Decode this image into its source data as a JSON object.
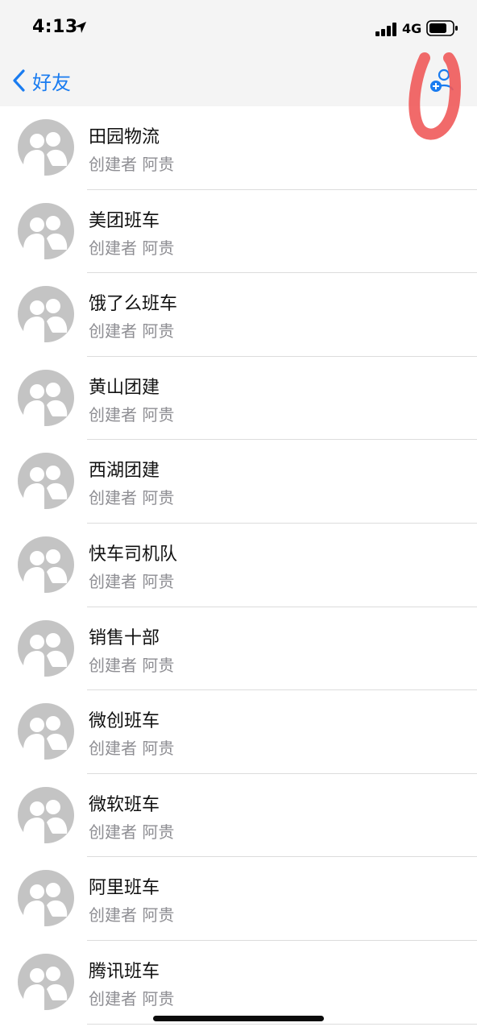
{
  "status": {
    "time": "4:13",
    "network": "4G"
  },
  "nav": {
    "back_label": "好友"
  },
  "groups": [
    {
      "name": "田园物流",
      "creator": "创建者 阿贵"
    },
    {
      "name": "美团班车",
      "creator": "创建者 阿贵"
    },
    {
      "name": "饿了么班车",
      "creator": "创建者 阿贵"
    },
    {
      "name": "黄山团建",
      "creator": "创建者 阿贵"
    },
    {
      "name": "西湖团建",
      "creator": "创建者 阿贵"
    },
    {
      "name": "快车司机队",
      "creator": "创建者 阿贵"
    },
    {
      "name": "销售十部",
      "creator": "创建者 阿贵"
    },
    {
      "name": "微创班车",
      "creator": "创建者 阿贵"
    },
    {
      "name": "微软班车",
      "creator": "创建者 阿贵"
    },
    {
      "name": "阿里班车",
      "creator": "创建者 阿贵"
    },
    {
      "name": "腾讯班车",
      "creator": "创建者 阿贵"
    }
  ],
  "colors": {
    "accent": "#1a7cf0",
    "avatar": "#c4c4c4",
    "annotation": "#f05a5a"
  }
}
